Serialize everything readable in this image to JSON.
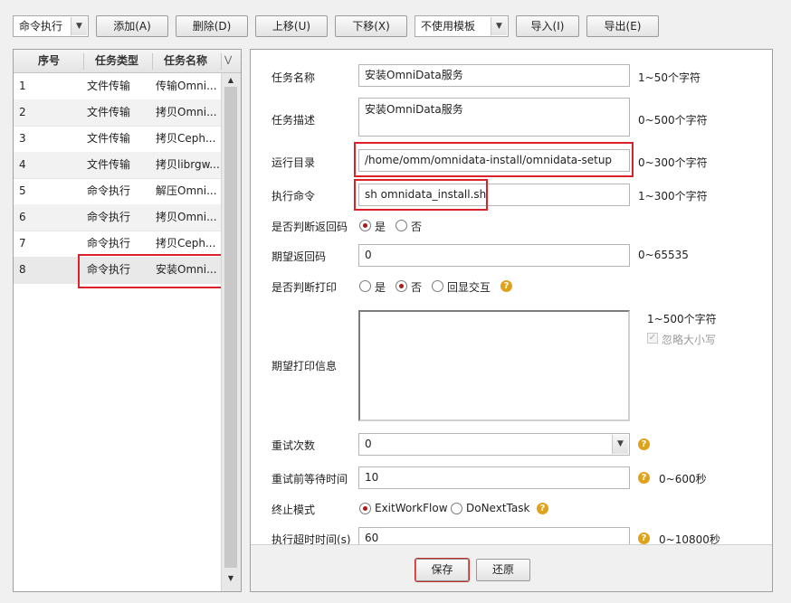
{
  "toolbar": {
    "task_type": "命令执行",
    "add": "添加(A)",
    "delete": "删除(D)",
    "move_up": "上移(U)",
    "move_down": "下移(X)",
    "template": "不使用模板",
    "import": "导入(I)",
    "export": "导出(E)"
  },
  "task_list": {
    "headers": {
      "seq": "序号",
      "type": "任务类型",
      "name": "任务名称"
    },
    "rows": [
      {
        "seq": "1",
        "type": "文件传输",
        "name": "传输Omni..."
      },
      {
        "seq": "2",
        "type": "文件传输",
        "name": "拷贝Omni..."
      },
      {
        "seq": "3",
        "type": "文件传输",
        "name": "拷贝Ceph..."
      },
      {
        "seq": "4",
        "type": "文件传输",
        "name": "拷贝librgw..."
      },
      {
        "seq": "5",
        "type": "命令执行",
        "name": "解压Omni..."
      },
      {
        "seq": "6",
        "type": "命令执行",
        "name": "拷贝Omni..."
      },
      {
        "seq": "7",
        "type": "命令执行",
        "name": "拷贝Ceph..."
      },
      {
        "seq": "8",
        "type": "命令执行",
        "name": "安装Omni..."
      }
    ]
  },
  "form": {
    "task_name": {
      "label": "任务名称",
      "value": "安装OmniData服务",
      "hint": "1~50个字符"
    },
    "task_desc": {
      "label": "任务描述",
      "value": "安装OmniData服务",
      "hint": "0~500个字符"
    },
    "run_dir": {
      "label": "运行目录",
      "value": "/home/omm/omnidata-install/omnidata-setup",
      "hint": "0~300个字符"
    },
    "command": {
      "label": "执行命令",
      "value": "sh omnidata_install.sh",
      "hint": "1~300个字符"
    },
    "check_return": {
      "label": "是否判断返回码",
      "yes": "是",
      "no": "否"
    },
    "expected_return": {
      "label": "期望返回码",
      "value": "0",
      "hint": "0~65535"
    },
    "check_print": {
      "label": "是否判断打印",
      "yes": "是",
      "no": "否",
      "echo": "回显交互"
    },
    "expected_print": {
      "label": "期望打印信息",
      "value": "",
      "hint": "1~500个字符",
      "ignore_case": "忽略大小写"
    },
    "retry_count": {
      "label": "重试次数",
      "value": "0"
    },
    "retry_wait": {
      "label": "重试前等待时间",
      "value": "10",
      "hint": "0~600秒"
    },
    "stop_mode": {
      "label": "终止模式",
      "opt1": "ExitWorkFlow",
      "opt2": "DoNextTask"
    },
    "timeout": {
      "label": "执行超时时间(s)",
      "value": "60",
      "hint": "0~10800秒"
    }
  },
  "actions": {
    "save": "保存",
    "restore": "还原"
  },
  "colors": {
    "highlight": "#d9222a",
    "radio_selected": "#b01818",
    "help": "#e0a21a"
  }
}
